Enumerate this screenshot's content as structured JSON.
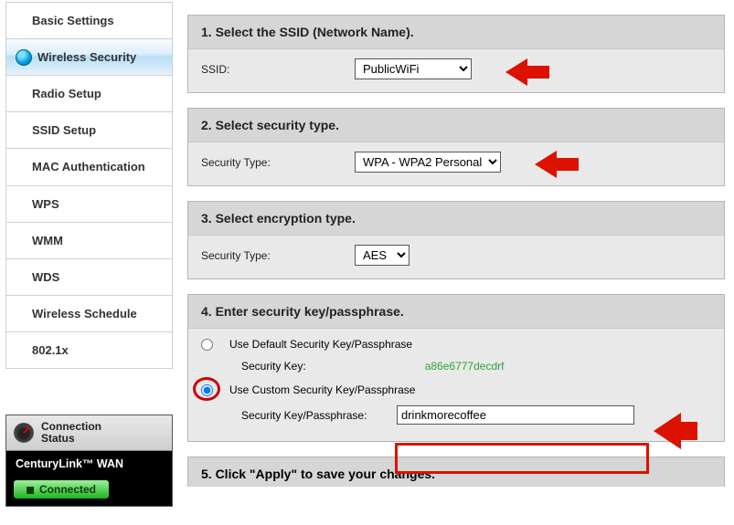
{
  "sidebar": {
    "items": [
      "Basic Settings",
      "Wireless Security",
      "Radio Setup",
      "SSID Setup",
      "MAC Authentication",
      "WPS",
      "WMM",
      "WDS",
      "Wireless Schedule",
      "802.1x"
    ]
  },
  "conn": {
    "title_line1": "Connection",
    "title_line2": "Status",
    "wan": "CenturyLink™ WAN",
    "state": "Connected"
  },
  "sections": {
    "s1": {
      "head": "1. Select the SSID (Network Name).",
      "label": "SSID:",
      "value": "PublicWiFi"
    },
    "s2": {
      "head": "2. Select security type.",
      "label": "Security Type:",
      "value": "WPA - WPA2 Personal"
    },
    "s3": {
      "head": "3. Select encryption type.",
      "label": "Security Type:",
      "value": "AES"
    },
    "s4": {
      "head": "4. Enter security key/passphrase.",
      "opt_default": "Use Default Security Key/Passphrase",
      "default_key_label": "Security Key:",
      "default_key_value": "a86e6777decdrf",
      "opt_custom": "Use Custom Security Key/Passphrase",
      "custom_label": "Security Key/Passphrase:",
      "custom_value": "drinkmorecoffee"
    },
    "s5": {
      "head": "5. Click \"Apply\" to save your changes."
    }
  }
}
